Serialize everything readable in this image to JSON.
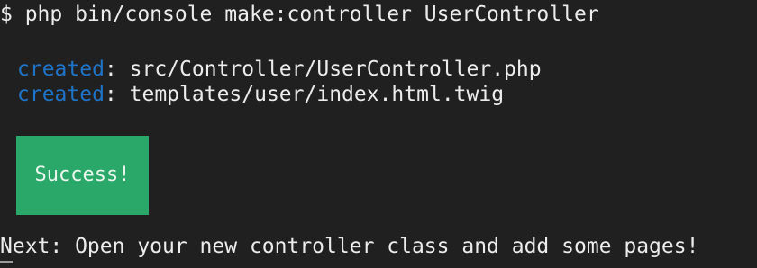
{
  "terminal": {
    "command_line": "$ php bin/console make:controller UserController",
    "output": [
      {
        "tag": "created",
        "separator": ": ",
        "path": "src/Controller/UserController.php"
      },
      {
        "tag": "created",
        "separator": ": ",
        "path": "templates/user/index.html.twig"
      }
    ],
    "success_label": "Success!",
    "next_message": "Next: Open your new controller class and add some pages!"
  },
  "colors": {
    "background": "#202020",
    "text": "#ececec",
    "created_tag": "#1e74c8",
    "success_bg": "#2aa86a"
  }
}
